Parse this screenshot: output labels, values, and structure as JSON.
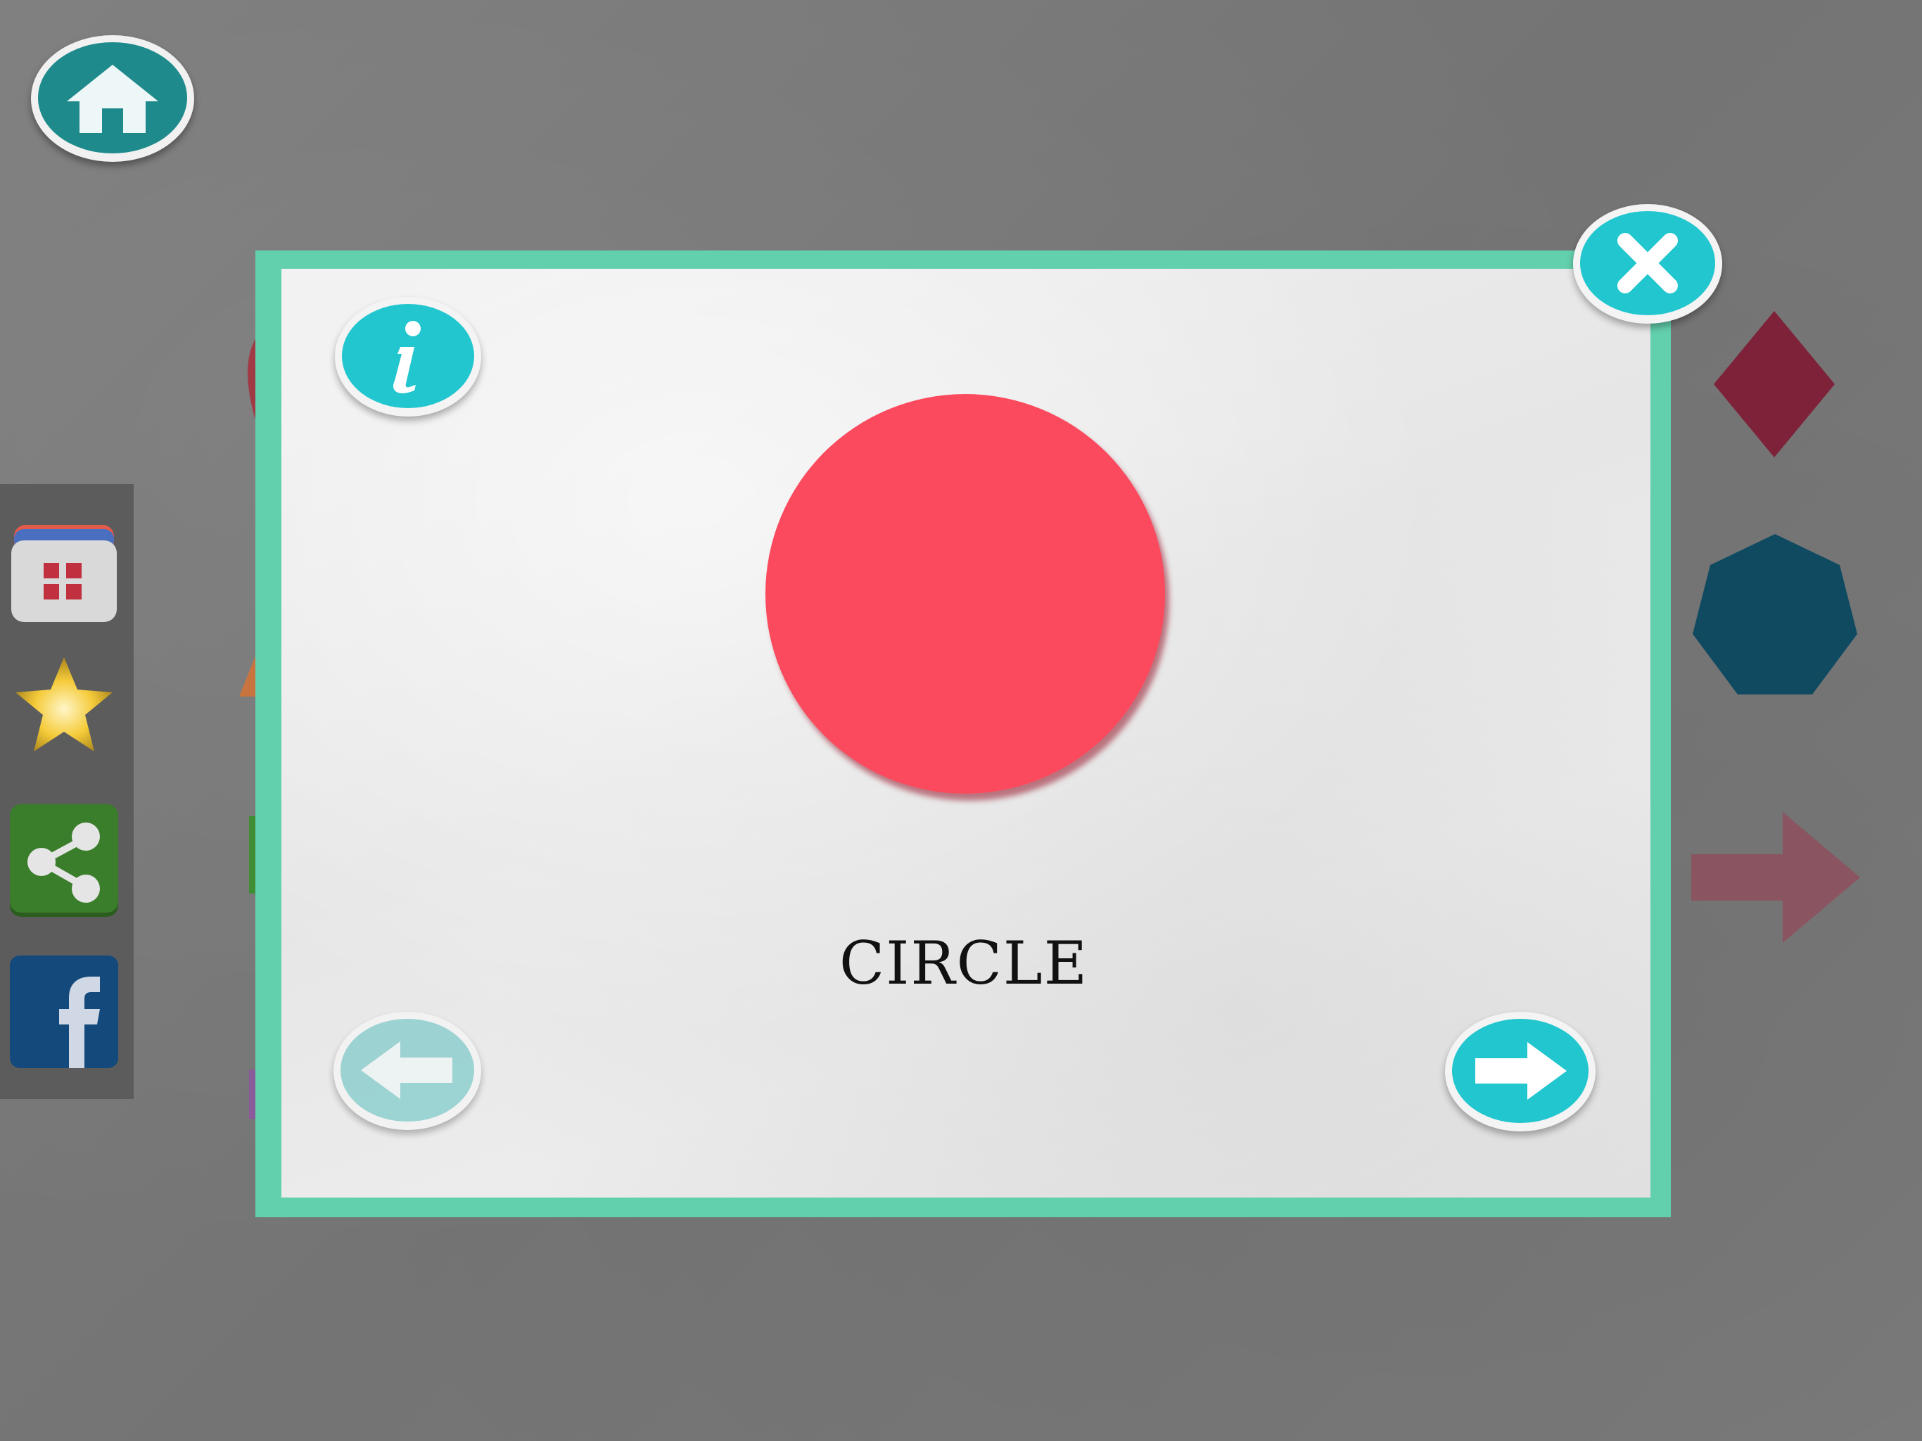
{
  "app": {
    "nav": {
      "home_icon": "home-icon"
    },
    "side_panel": {
      "items": [
        {
          "icon": "calendar-grid-icon"
        },
        {
          "icon": "star-icon"
        },
        {
          "icon": "share-icon"
        },
        {
          "icon": "facebook-icon"
        }
      ]
    },
    "background_shapes": [
      "diamond",
      "heptagon",
      "arrow"
    ]
  },
  "modal": {
    "info_icon": "info-icon",
    "close_icon": "close-icon",
    "prev_icon": "arrow-left-icon",
    "next_icon": "arrow-right-icon",
    "shape": "circle",
    "shape_color": "#fb4a5e",
    "shape_name": "CIRCLE",
    "frame_color": "#62cfad",
    "button_color": "#22c6cf"
  }
}
